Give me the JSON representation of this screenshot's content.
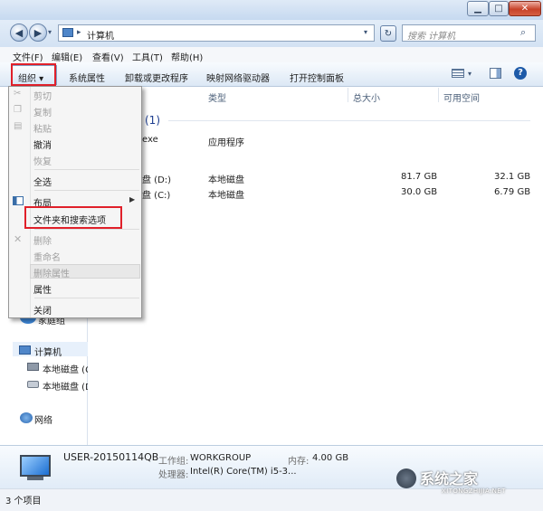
{
  "addressbar": {
    "path": "计算机",
    "search_placeholder": "搜索 计算机"
  },
  "menubar": [
    "文件(F)",
    "编辑(E)",
    "查看(V)",
    "工具(T)",
    "帮助(H)"
  ],
  "toolbar": {
    "organize": "组织 ▾",
    "commands": [
      "系统属性",
      "卸载或更改程序",
      "映射网络驱动器",
      "打开控制面板"
    ]
  },
  "columns": {
    "type": "类型",
    "total": "总大小",
    "free": "可用空间"
  },
  "content": {
    "group_header": "(1)",
    "app_name": "exe",
    "app_type": "应用程序",
    "drives": [
      {
        "name": "盘 (D:)",
        "type": "本地磁盘",
        "total": "81.7 GB",
        "free": "32.1 GB"
      },
      {
        "name": "盘 (C:)",
        "type": "本地磁盘",
        "total": "30.0 GB",
        "free": "6.79 GB"
      }
    ]
  },
  "organize_menu": {
    "cut": "剪切",
    "copy": "复制",
    "paste": "粘贴",
    "undo": "撤消",
    "redo": "恢复",
    "select_all": "全选",
    "layout": "布局",
    "folder_options": "文件夹和搜索选项",
    "delete": "删除",
    "rename": "重命名",
    "remove_properties": "删除属性",
    "properties": "属性",
    "close": "关闭"
  },
  "navpane": {
    "partial_label": "家庭组",
    "computer": "计算机",
    "drive1": "本地磁盘 (C",
    "drive2": "本地磁盘 (D",
    "network": "网络"
  },
  "details": {
    "computer_name": "USER-20150114QB",
    "workgroup_label": "工作组:",
    "workgroup": "WORKGROUP",
    "memory_label": "内存:",
    "memory": "4.00 GB",
    "cpu_label": "处理器:",
    "cpu": "Intel(R) Core(TM) i5-3..."
  },
  "status": {
    "items": "3 个项目"
  },
  "watermark": {
    "text": "系统之家",
    "sub": "XITONGZHIJIA.NET"
  },
  "colors": {
    "highlight_box": "#e0202a",
    "accent": "#1d5aa8"
  }
}
